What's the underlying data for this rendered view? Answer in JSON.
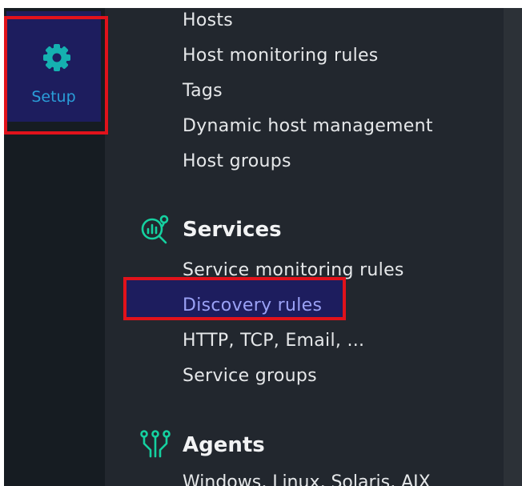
{
  "sidebar": {
    "setup_label": "Setup"
  },
  "hosts_menu": {
    "items": [
      "Hosts",
      "Host monitoring rules",
      "Tags",
      "Dynamic host management",
      "Host groups"
    ]
  },
  "services_section": {
    "title": "Services",
    "icon": "services-chart-magnifier-icon",
    "items": [
      "Service monitoring rules",
      "Discovery rules",
      "HTTP, TCP, Email, ...",
      "Service groups"
    ],
    "active_item": "Discovery rules"
  },
  "agents_section": {
    "title": "Agents",
    "icon": "agents-plug-icon",
    "items": [
      "Windows, Linux, Solaris, AIX"
    ]
  },
  "colors": {
    "sidebar_bg": "#161c22",
    "panel_bg": "#22272e",
    "active_bg": "#1d1d5e",
    "accent_green": "#15d1a0",
    "accent_blue": "#2a9ed9",
    "active_text": "#9aa1f5",
    "highlight_border": "#e1121b"
  }
}
